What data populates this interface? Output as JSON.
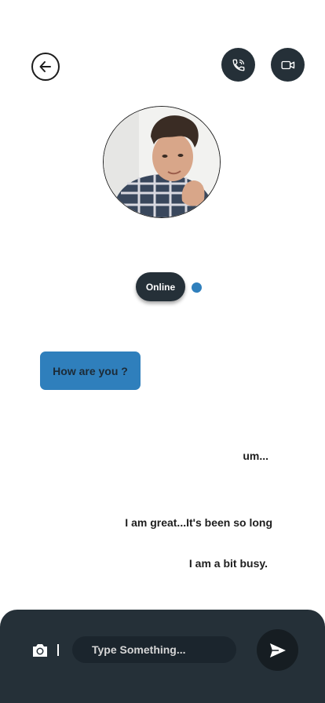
{
  "header": {
    "back_icon": "arrow-left-icon",
    "call_icon": "phone-call-icon",
    "video_icon": "video-camera-icon"
  },
  "contact": {
    "status": "Online",
    "status_dot_color": "#2f7fbc"
  },
  "messages": {
    "incoming": [
      {
        "text": "How are you ?"
      }
    ],
    "outgoing": [
      {
        "text": "um..."
      },
      {
        "text": "I am great...It's been so long"
      },
      {
        "text": "I am a bit busy."
      }
    ]
  },
  "composer": {
    "camera_icon": "camera-icon",
    "placeholder": "Type Something...",
    "send_icon": "send-icon"
  },
  "colors": {
    "dark": "#253038",
    "accent": "#2f7fbc",
    "send_bg": "#161d22"
  }
}
